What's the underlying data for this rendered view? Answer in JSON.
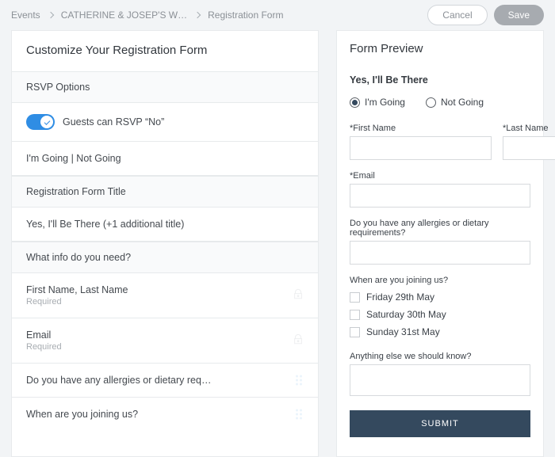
{
  "breadcrumb": {
    "a": "Events",
    "b": "CATHERINE & JOSEP'S W…",
    "c": "Registration Form"
  },
  "actions": {
    "cancel": "Cancel",
    "save": "Save"
  },
  "left": {
    "title": "Customize Your Registration Form",
    "sec_rsvp": "RSVP Options",
    "rsvp_toggle_label": "Guests can RSVP “No”",
    "going_labels": "I'm Going | Not Going",
    "sec_title": "Registration Form Title",
    "title_value": "Yes, I'll Be There (+1 additional title)",
    "sec_info": "What info do you need?",
    "f1": "First Name, Last Name",
    "f1_sub": "Required",
    "f2": "Email",
    "f2_sub": "Required",
    "f3": "Do you have any allergies or dietary req…",
    "f4": "When are you joining us?"
  },
  "preview": {
    "title": "Form Preview",
    "subtitle": "Yes, I'll Be There",
    "radio_going": "I'm Going",
    "radio_notgoing": "Not Going",
    "first": "*First Name",
    "last": "*Last Name",
    "email": "*Email",
    "allergy_q": "Do you have any allergies or dietary requirements?",
    "when_q": "When are you joining us?",
    "opt1": "Friday 29th May",
    "opt2": "Saturday 30th May",
    "opt3": "Sunday 31st May",
    "anything": "Anything else we should know?",
    "submit": "SUBMIT"
  }
}
